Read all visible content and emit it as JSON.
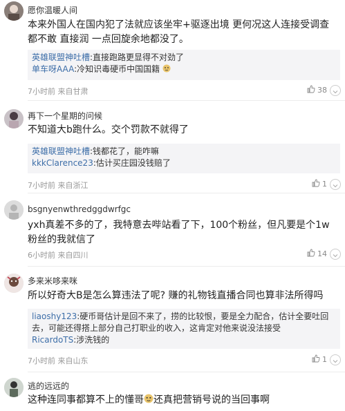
{
  "comments": [
    {
      "username": "愿你温暖人间",
      "text": "本来外国人在国内犯了法就应该坐牢+驱逐出境 更何况这人连接受调查都不敢 直接润 一点回旋余地都没了。",
      "replies": [
        {
          "name": "英雄联盟神吐槽",
          "text": ":直接跑路更显得不对劲了"
        },
        {
          "name": "单车呀AAA",
          "text": ":冷知识毒硬币中国国籍"
        }
      ],
      "time": "7小时前",
      "location": "来自甘肃",
      "likes": "38"
    },
    {
      "username": "再下一个星期的问候",
      "text": "不知道大b跑什么。交个罚款不就得了",
      "replies": [
        {
          "name": "英雄联盟神吐槽",
          "text": ":钱都花了，能咋嘛"
        },
        {
          "name": "kkkClarence23",
          "text": ":估计买庄园没钱赔了"
        }
      ],
      "time": "7小时前",
      "location": "来自浙江",
      "likes": "1"
    },
    {
      "username": "bsgnyenwthredggdwrfgc",
      "text": "yxh真差不多的了，我特意去哔站看了下，100个粉丝，但凡要是个1w粉丝的我就信了",
      "replies": [],
      "time": "6小时前",
      "location": "来自四川",
      "likes": "14"
    },
    {
      "username": "多来米哆来咪",
      "text": "所以好奇大B是怎么算违法了呢? 赚的礼物钱直播合同也算非法所得吗",
      "replies": [
        {
          "name": "liaoshy123",
          "text": ":硬币哥估计是回不来了，捞的比较恨，要是全力配合，估计全要吐回去，可能还得搭上部分自己打职业的收入，这肯定对他来说没法接受"
        },
        {
          "name": "RicardoTS",
          "text": ":涉洗钱的"
        }
      ],
      "time": "7小时前",
      "location": "来自山东",
      "likes": "1"
    },
    {
      "username": "逃的远远的",
      "text": "这种连同事都算不上的懂哥",
      "text_after_emoji": "还真把营销号说的当回事啊",
      "replies": [],
      "time": "",
      "location": "",
      "likes": ""
    }
  ],
  "icons": {
    "like": "thumb-up-icon",
    "more": "chevron-down-icon",
    "emoji": "doge-emoji-icon"
  }
}
